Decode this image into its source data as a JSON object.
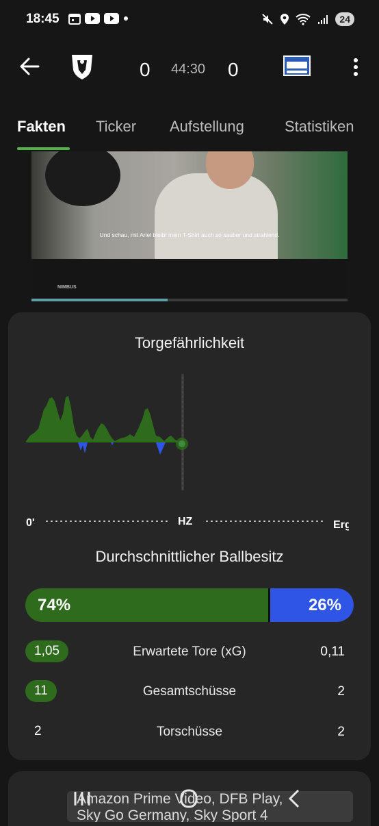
{
  "status": {
    "time": "18:45",
    "battery": "24",
    "net": "5"
  },
  "match": {
    "home_score": "0",
    "away_score": "0",
    "clock": "44:30"
  },
  "tabs": [
    "Fakten",
    "Ticker",
    "Aufstellung",
    "Statistiken"
  ],
  "video": {
    "subtitle": "Und schau, mit Ariel bleibt mein T-Shirt auch so sauber und strahlend.",
    "brand": "NIMBUS",
    "progress": 0.43
  },
  "danger": {
    "title": "Torgefährlichkeit",
    "start_label": "0'",
    "half_label": "HZ",
    "end_label": "Erg"
  },
  "possession": {
    "title": "Durchschnittlicher Ballbesitz",
    "home": "74%",
    "away": "26%",
    "home_value": 74,
    "away_value": 26
  },
  "stats": [
    {
      "label": "Erwartete Tore (xG)",
      "home": "1,05",
      "away": "0,11",
      "home_highlight": true
    },
    {
      "label": "Gesamtschüsse",
      "home": "11",
      "away": "2",
      "home_highlight": true
    },
    {
      "label": "Torschüsse",
      "home": "2",
      "away": "2",
      "home_highlight": false
    }
  ],
  "broadcast": {
    "line1": "Amazon Prime Video, DFB Play,",
    "line2": "Sky Go Germany, Sky Sport 4"
  },
  "colors": {
    "home": "#2e6b1c",
    "away": "#2e55e6",
    "accent": "#53b34a"
  }
}
